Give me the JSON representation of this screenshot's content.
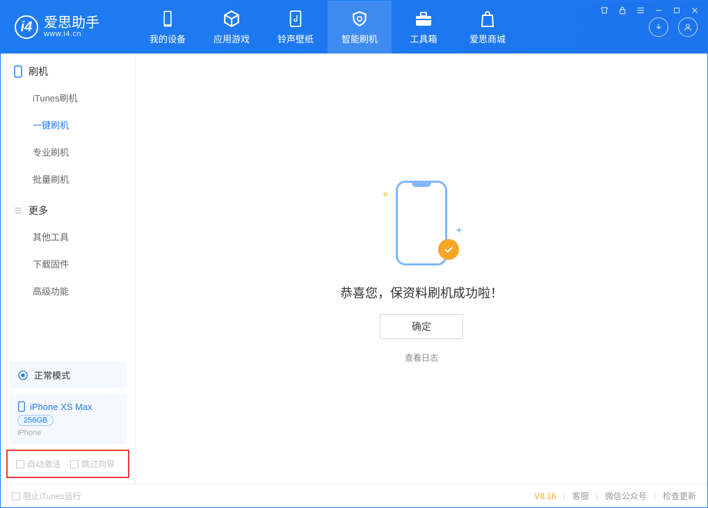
{
  "app": {
    "name": "爱思助手",
    "domain": "www.i4.cn"
  },
  "header_tabs": [
    {
      "label": "我的设备"
    },
    {
      "label": "应用游戏"
    },
    {
      "label": "铃声壁纸"
    },
    {
      "label": "智能刷机",
      "active": true
    },
    {
      "label": "工具箱"
    },
    {
      "label": "爱思商城"
    }
  ],
  "sidebar": {
    "section_flash": "刷机",
    "items_flash": [
      {
        "label": "iTunes刷机"
      },
      {
        "label": "一键刷机",
        "active": true
      },
      {
        "label": "专业刷机"
      },
      {
        "label": "批量刷机"
      }
    ],
    "section_more": "更多",
    "items_more": [
      {
        "label": "其他工具"
      },
      {
        "label": "下载固件"
      },
      {
        "label": "高级功能"
      }
    ]
  },
  "mode": {
    "label": "正常模式"
  },
  "device": {
    "name": "iPhone XS Max",
    "storage": "256GB",
    "type": "iPhone"
  },
  "options": {
    "auto_activate": "自动激活",
    "skip_guide": "跳过向导"
  },
  "main": {
    "success_text": "恭喜您，保资料刷机成功啦！",
    "ok_button": "确定",
    "view_log": "查看日志"
  },
  "footer": {
    "block_itunes": "阻止iTunes运行",
    "version": "V8.16",
    "support": "客服",
    "wechat": "微信公众号",
    "update": "检查更新"
  }
}
